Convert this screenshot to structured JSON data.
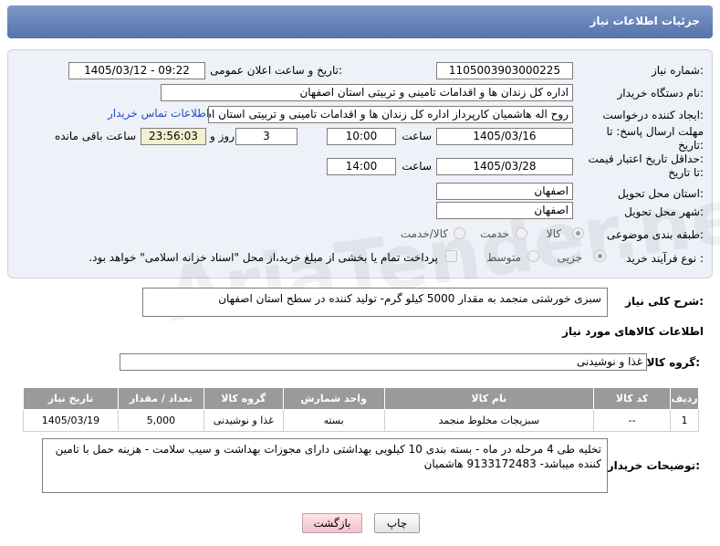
{
  "header": {
    "title": "جزئیات اطلاعات نیاز"
  },
  "form": {
    "need_number_label": "شماره نیاز:",
    "need_number": "1105003903000225",
    "announce_label": "تاریخ و ساعت اعلان عمومی:",
    "announce_value": "1405/03/12 - 09:22",
    "buyer_org_label": "نام دستگاه خریدار:",
    "buyer_org": "اداره کل زندان ها و اقدامات تامینی و تربیتی استان اصفهان",
    "requester_label": "ایجاد کننده درخواست:",
    "requester": "روح اله هاشمیان کارپرداز اداره کل زندان ها و اقدامات تامینی و تربیتی استان اصفهان",
    "contact_link": "اطلاعات تماس خریدار",
    "deadline_label_1": "مهلت ارسال پاسخ: تا",
    "deadline_label_2": "تاریخ:",
    "deadline_date": "1405/03/16",
    "time_label": "ساعت",
    "deadline_time": "10:00",
    "days_value": "3",
    "days_label": "روز و",
    "remaining_time": "23:56:03",
    "remaining_label": "ساعت باقی مانده",
    "validity_label_1": "حداقل تاریخ اعتبار قیمت:",
    "validity_label_2": "تا تاریخ:",
    "validity_date": "1405/03/28",
    "validity_time": "14:00",
    "province_label": "استان محل تحویل:",
    "province": "اصفهان",
    "city_label": "شهر محل تحویل:",
    "city": "اصفهان",
    "category_label": "طبقه بندی موضوعی:",
    "category_options": [
      "کالا",
      "خدمت",
      "کالا/خدمت"
    ],
    "process_label": "نوع فرآیند خرید :",
    "process_options": [
      "جزیی",
      "متوسط"
    ],
    "payment_note": "پرداخت تمام یا بخشی از مبلغ خرید،از محل \"اسناد خزانه اسلامی\" خواهد بود."
  },
  "summary": {
    "label": "شرح کلی نیاز:",
    "text": "سبزی خورشتی منجمد به مقدار 5000 کیلو گرم- تولید کننده در سطح استان اصفهان"
  },
  "goods": {
    "section_title": "اطلاعات کالاهای مورد نیاز",
    "group_label": "گروه کالا:",
    "group_value": "غذا و نوشیدنی",
    "columns": [
      "ردیف",
      "کد کالا",
      "نام کالا",
      "واحد شمارش",
      "گروه کالا",
      "تعداد / مقدار",
      "تاریخ نیاز"
    ],
    "rows": [
      [
        "1",
        "--",
        "سبزیجات مخلوط منجمد",
        "بسته",
        "غذا و نوشیدنی",
        "5,000",
        "1405/03/19"
      ]
    ]
  },
  "notes": {
    "label": "توضیحات خریدار:",
    "text": "تخلیه طی 4 مرحله در ماه - بسته بندی 10 کیلویی بهداشتی دارای مجوزات بهداشت و سیب سلامت - هزینه حمل با تامین کننده میباشد- 9133172483 هاشمیان"
  },
  "buttons": {
    "print": "چاپ",
    "back": "بازگشت"
  },
  "watermark": "AriaTender.net"
}
